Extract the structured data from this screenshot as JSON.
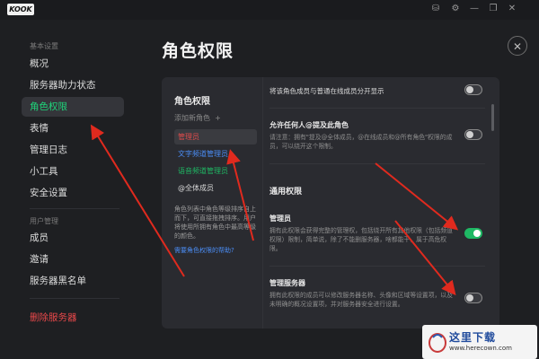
{
  "titlebar": {
    "logo": "KOOK"
  },
  "sidebar": {
    "section1": "基本设置",
    "items1": [
      "概况",
      "服务器助力状态",
      "角色权限",
      "表情",
      "管理日志",
      "小工具",
      "安全设置"
    ],
    "section2": "用户管理",
    "items2": [
      "成员",
      "邀请",
      "服务器黑名单"
    ],
    "danger": "删除服务器"
  },
  "main": {
    "title": "角色权限",
    "close": "✕"
  },
  "roles": {
    "title": "角色权限",
    "add": "添加新角色",
    "add_icon": "+",
    "list": [
      "管理员",
      "文字频道管理员",
      "语音频道管理员",
      "@全体成员"
    ],
    "colors": [
      "#e04b4b",
      "#4b8df5",
      "#1fb864",
      "#d8d8d8"
    ],
    "desc": "角色列表中角色等级排序自上而下，可直接拖拽排序。用户将使用所拥有角色中最高等级的颜色。",
    "help": "需要角色权限的帮助?"
  },
  "perms": {
    "p1_title": "将该角色成员与普通在线成员分开显示",
    "p2_title": "允许任何人@提及此角色",
    "p2_desc": "请注意：拥有\"提及@全体成员，@在线成员和@所有角色\"权限的成员，可以绕开这个限制。",
    "group_title": "通用权限",
    "p3_title": "管理员",
    "p3_desc": "拥有此权限会获得完整的管理权，包括绕开所有其他权限（包括频道权限）限制，简单说，除了不能删服务器，啥都能干，属于高危权限。",
    "p4_title": "管理服务器",
    "p4_desc": "拥有此权限的成员可以修改服务器名称、头像和区域等设置项，以及未明确的概况设置项，并对服务器安全进行设置。"
  },
  "watermark": {
    "cn": "这里下载",
    "url": "www.herecown.com"
  }
}
